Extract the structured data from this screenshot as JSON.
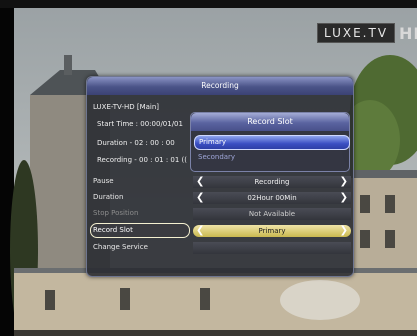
{
  "logo": {
    "brand": "LUXE.TV",
    "suffix": "HD"
  },
  "dialog": {
    "title": "Recording",
    "channel": "LUXE-TV-HD [Main]",
    "start_time": "Start Time : 00:00/01/01",
    "duration": "Duration - 02 : 00 : 00",
    "recording": "Recording - 00 : 01 : 01 (("
  },
  "rows": [
    {
      "label": "Pause",
      "value": "Recording",
      "arrows": true
    },
    {
      "label": "Duration",
      "value": "02Hour 00Min",
      "arrows": true
    },
    {
      "label": "Stop Position",
      "value": "Not Available",
      "arrows": false
    },
    {
      "label": "Record Slot",
      "value": "Primary",
      "arrows": true
    },
    {
      "label": "Change Service",
      "value": "",
      "arrows": false
    }
  ],
  "popup": {
    "title": "Record Slot",
    "options": [
      "Primary",
      "Secondary"
    ],
    "selected": "Primary"
  },
  "arrows": {
    "left": "❮",
    "right": "❯"
  }
}
